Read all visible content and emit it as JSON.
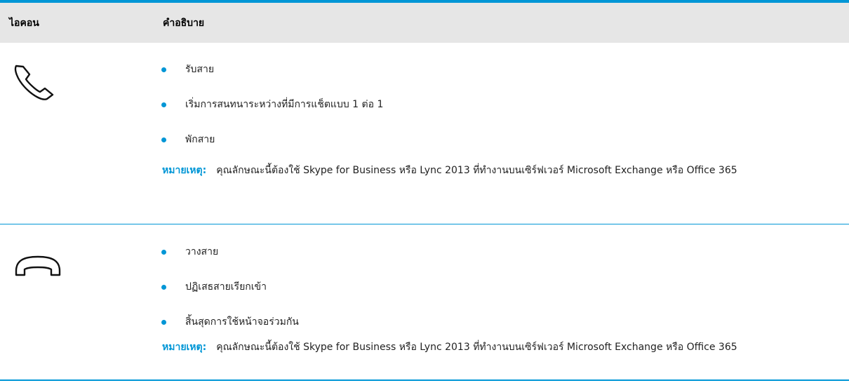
{
  "table": {
    "headers": {
      "icon": "ไอคอน",
      "description": "คำอธิบาย"
    },
    "rows": [
      {
        "icon": "phone-answer-icon",
        "bullets": [
          "รับสาย",
          "เริ่มการสนทนาระหว่างที่มีการแช็ตแบบ 1 ต่อ 1",
          "พักสาย"
        ],
        "note_label": "หมายเหตุ:",
        "note_text": "คุณลักษณะนี้ต้องใช้ Skype for Business หรือ Lync 2013 ที่ทำงานบนเซิร์ฟเวอร์ Microsoft Exchange หรือ Office 365"
      },
      {
        "icon": "phone-hangup-icon",
        "bullets": [
          "วางสาย",
          "ปฏิเสธสายเรียกเข้า",
          "สิ้นสุดการใช้หน้าจอร่วมกัน"
        ],
        "note_label": "หมายเหตุ:",
        "note_text": "คุณลักษณะนี้ต้องใช้ Skype for Business หรือ Lync 2013 ที่ทำงานบนเซิร์ฟเวอร์ Microsoft Exchange หรือ Office 365"
      }
    ]
  },
  "colors": {
    "accent": "#0096d6",
    "header_bg": "#e6e6e6"
  }
}
